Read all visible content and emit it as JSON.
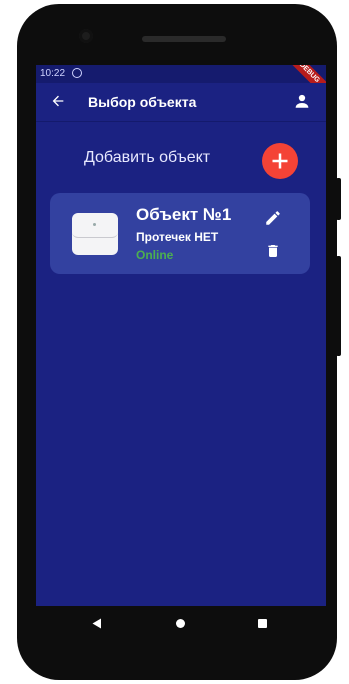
{
  "status_bar": {
    "time": "10:22",
    "debug_banner": "DEBUG"
  },
  "app_bar": {
    "title": "Выбор объекта"
  },
  "add_object": {
    "label": "Добавить объект"
  },
  "objects": [
    {
      "title": "Объект №1",
      "leak_status": "Протечек НЕТ",
      "connection": "Online"
    }
  ],
  "colors": {
    "background": "#1b2282",
    "card": "#3341a0",
    "accent_add": "#f44336",
    "online": "#4caf50"
  }
}
